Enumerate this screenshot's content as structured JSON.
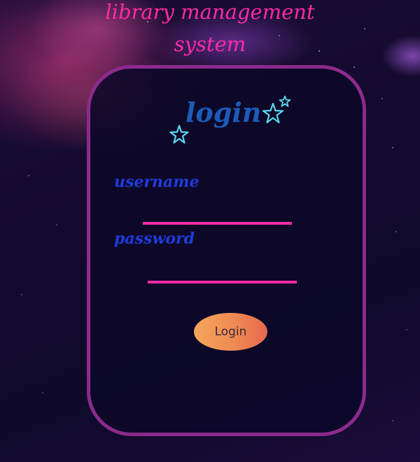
{
  "header": {
    "title_line1": "library management",
    "title_line2": "system"
  },
  "login_form": {
    "heading": "login",
    "username_label": "username",
    "username_value": "",
    "password_label": "password",
    "password_value": "",
    "submit_label": "Login"
  },
  "icons": {
    "doodle_star_large": "star-icon",
    "doodle_star_small": "star-icon",
    "doodle_star_left": "star-icon"
  },
  "colors": {
    "title": "#ff2aa8",
    "heading": "#1c5bb8",
    "labels": "#1f3bdc",
    "card_border": "#8d2a8e",
    "input_underline": "#ff2aa8",
    "button_from": "#f5a65c",
    "button_to": "#e8684f",
    "star_doodles": "#5ad6f0"
  }
}
